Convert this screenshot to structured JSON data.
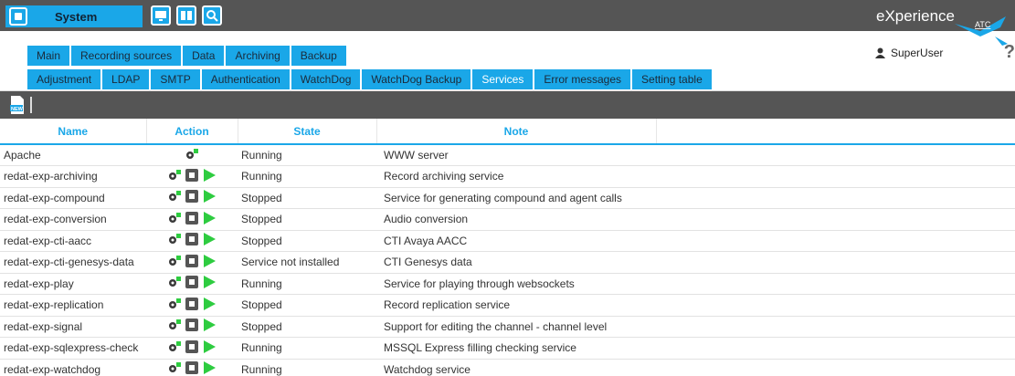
{
  "header": {
    "system_label": "System",
    "brand": "eXperience",
    "logo_text": "ATC",
    "user": "SuperUser",
    "help": "?"
  },
  "tabs_main": [
    {
      "label": "Main"
    },
    {
      "label": "Recording sources"
    },
    {
      "label": "Data"
    },
    {
      "label": "Archiving"
    },
    {
      "label": "Backup"
    }
  ],
  "tabs_sub": [
    {
      "label": "Adjustment"
    },
    {
      "label": "LDAP"
    },
    {
      "label": "SMTP"
    },
    {
      "label": "Authentication"
    },
    {
      "label": "WatchDog"
    },
    {
      "label": "WatchDog Backup"
    },
    {
      "label": "Services",
      "active": true
    },
    {
      "label": "Error messages"
    },
    {
      "label": "Setting table"
    }
  ],
  "toolbar": {
    "new_label": "NEW"
  },
  "table": {
    "columns": [
      "Name",
      "Action",
      "State",
      "Note"
    ],
    "rows": [
      {
        "name": "Apache",
        "state": "Running",
        "note": "WWW server",
        "actions": [
          "settings"
        ]
      },
      {
        "name": "redat-exp-archiving",
        "state": "Running",
        "note": "Record archiving service",
        "actions": [
          "settings",
          "stop",
          "start"
        ]
      },
      {
        "name": "redat-exp-compound",
        "state": "Stopped",
        "note": "Service for generating compound and agent calls",
        "actions": [
          "settings",
          "stop",
          "start"
        ]
      },
      {
        "name": "redat-exp-conversion",
        "state": "Stopped",
        "note": "Audio conversion",
        "actions": [
          "settings",
          "stop",
          "start"
        ]
      },
      {
        "name": "redat-exp-cti-aacc",
        "state": "Stopped",
        "note": "CTI Avaya AACC",
        "actions": [
          "settings",
          "stop",
          "start"
        ]
      },
      {
        "name": "redat-exp-cti-genesys-data",
        "state": "Service not installed",
        "note": "CTI Genesys data",
        "actions": [
          "settings",
          "stop",
          "start"
        ]
      },
      {
        "name": "redat-exp-play",
        "state": "Running",
        "note": "Service for playing through websockets",
        "actions": [
          "settings",
          "stop",
          "start"
        ]
      },
      {
        "name": "redat-exp-replication",
        "state": "Stopped",
        "note": "Record replication service",
        "actions": [
          "settings",
          "stop",
          "start"
        ]
      },
      {
        "name": "redat-exp-signal",
        "state": "Stopped",
        "note": "Support for editing the channel - channel level",
        "actions": [
          "settings",
          "stop",
          "start"
        ]
      },
      {
        "name": "redat-exp-sqlexpress-check",
        "state": "Running",
        "note": "MSSQL Express filling checking service",
        "actions": [
          "settings",
          "stop",
          "start"
        ]
      },
      {
        "name": "redat-exp-watchdog",
        "state": "Running",
        "note": "Watchdog service",
        "actions": [
          "settings",
          "stop",
          "start"
        ]
      }
    ]
  },
  "colors": {
    "accent": "#1aa7e8",
    "dark_bar": "#555555",
    "play": "#2ecc40"
  }
}
